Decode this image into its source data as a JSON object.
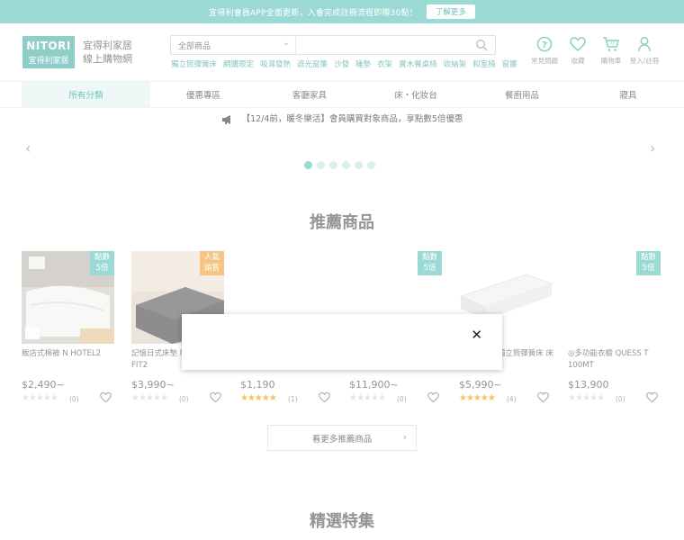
{
  "topbar": {
    "message": "宜得利會員APP全面更新，入會完成註冊流程即贈30點！",
    "button": "了解更多"
  },
  "logo": {
    "en": "NITORI",
    "zh": "宜得利家居"
  },
  "site_name": {
    "line1": "宜得利家居",
    "line2": "線上購物網"
  },
  "search": {
    "category": "全部商品",
    "placeholder": ""
  },
  "keywords": [
    "獨立筒彈簧床",
    "網購限定",
    "吸濕發熱",
    "遮光窗簾",
    "沙發",
    "睡墊",
    "衣架",
    "實木餐桌椅",
    "收納架",
    "和室椅",
    "窗簾"
  ],
  "header_icons": [
    {
      "label": "常見問題",
      "icon": "help-icon"
    },
    {
      "label": "收藏",
      "icon": "heart-icon"
    },
    {
      "label": "購物車",
      "icon": "cart-icon",
      "count": "0"
    },
    {
      "label": "登入/註冊",
      "icon": "user-icon"
    }
  ],
  "nav": [
    "所有分類",
    "優惠專區",
    "客廳家具",
    "床・化妝台",
    "餐廚用品",
    "寢具"
  ],
  "announcement": "【12/4前，暖冬樂活】會員購買對象商品，享點數5倍優惠",
  "carousel": {
    "dots": 6,
    "active": 1
  },
  "recommend": {
    "title": "推薦商品",
    "products": [
      {
        "name": "飯店式棉被 N HOTEL2",
        "price": "$2,490~",
        "rating": 0,
        "count": "(0)",
        "badge": "點數\n5倍"
      },
      {
        "name": "記憶日式床墊 R PREMIER FIT2",
        "price": "$3,990~",
        "rating": 0,
        "count": "(0)",
        "badge": "人氣\n銷售"
      },
      {
        "name": "",
        "price": "$1,190",
        "rating": 5,
        "count": "(1)",
        "badge": ""
      },
      {
        "name": "",
        "price": "$11,900~",
        "rating": 0,
        "count": "(0)",
        "badge": "點數\n5倍"
      },
      {
        "name": "獨立筒彈簧床 床",
        "price": "$5,990~",
        "rating": 5,
        "count": "(4)",
        "badge": ""
      },
      {
        "name": "◎多功能衣櫥 QUESS T 100MT",
        "price": "$13,900",
        "rating": 0,
        "count": "(0)",
        "badge": "點數\n5倍"
      }
    ],
    "more_button": "看更多推薦商品"
  },
  "featured": {
    "title": "精選特集"
  },
  "modal": {
    "close": "✕"
  },
  "colors": {
    "accent": "#7fcfc8",
    "accent_dark": "#3fb1a8",
    "star": "#f0b429",
    "badge_orange": "#f2b760"
  }
}
